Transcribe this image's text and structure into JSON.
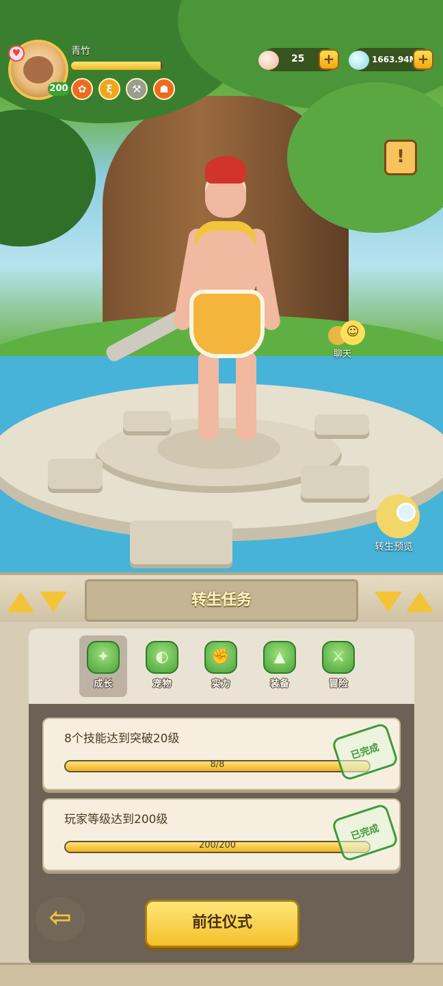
{
  "player": {
    "name": "青竹",
    "level": "200",
    "exp_fraction": 0.98
  },
  "buffs": [
    {
      "icon": "mushroom-buff-icon",
      "glyph": "✿",
      "color": "#ef6a1e"
    },
    {
      "icon": "swirl-buff-icon",
      "glyph": "ξ",
      "color": "#f2a51b"
    },
    {
      "icon": "axe-buff-icon",
      "glyph": "⚒",
      "color": "#9b9b8e"
    },
    {
      "icon": "cap-buff-icon",
      "glyph": "☗",
      "color": "#ef6a1e"
    }
  ],
  "resources": {
    "shell_amount": "25",
    "crystal_amount": "1663.94M",
    "plus": "+"
  },
  "side": {
    "chat_label": "聊天",
    "preview_label": "转生预览"
  },
  "panel": {
    "title": "转生任务",
    "tabs": [
      {
        "label": "成长",
        "icon": "growth-icon",
        "glyph": "✦"
      },
      {
        "label": "宠物",
        "icon": "pet-icon",
        "glyph": "◐"
      },
      {
        "label": "实力",
        "icon": "strength-icon",
        "glyph": "✊"
      },
      {
        "label": "装备",
        "icon": "equipment-icon",
        "glyph": "▲"
      },
      {
        "label": "冒险",
        "icon": "adventure-icon",
        "glyph": "⚔"
      }
    ],
    "active_tab": 0,
    "tasks": [
      {
        "title": "8个技能达到突破20级",
        "progress_text": "8/8",
        "fraction": 1.0,
        "stamp": "已完成"
      },
      {
        "title": "玩家等级达到200级",
        "progress_text": "200/200",
        "fraction": 1.0,
        "stamp": "已完成"
      }
    ],
    "go_button": "前往仪式",
    "back_glyph": "⇦"
  },
  "colors": {
    "accent_gold": "#f4c437",
    "complete_green": "#3d9a3a"
  }
}
